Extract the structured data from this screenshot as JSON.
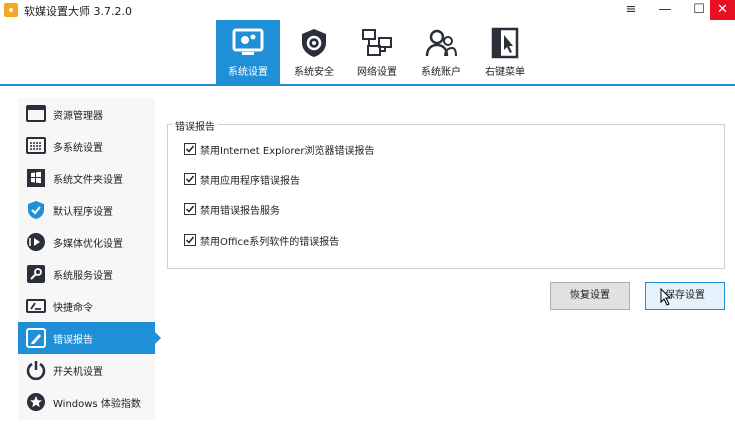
{
  "window": {
    "title": "软媒设置大师 3.7.2.0",
    "controls": {
      "menu": "≡",
      "minimize": "—",
      "maximize": "☐",
      "close": "✕"
    }
  },
  "toolbar": {
    "items": [
      {
        "label": "系统设置",
        "icon": "monitor-gear-icon",
        "active": true
      },
      {
        "label": "系统安全",
        "icon": "shield-gear-icon",
        "active": false
      },
      {
        "label": "网络设置",
        "icon": "network-icon",
        "active": false
      },
      {
        "label": "系统账户",
        "icon": "users-icon",
        "active": false
      },
      {
        "label": "右键菜单",
        "icon": "cursor-menu-icon",
        "active": false
      }
    ]
  },
  "sidebar": {
    "items": [
      {
        "label": "资源管理器",
        "icon": "explorer-icon",
        "active": false
      },
      {
        "label": "多系统设置",
        "icon": "multi-system-icon",
        "active": false
      },
      {
        "label": "系统文件夹设置",
        "icon": "windows-folder-icon",
        "active": false
      },
      {
        "label": "默认程序设置",
        "icon": "default-program-icon",
        "active": false
      },
      {
        "label": "多媒体优化设置",
        "icon": "multimedia-icon",
        "active": false
      },
      {
        "label": "系统服务设置",
        "icon": "service-icon",
        "active": false
      },
      {
        "label": "快捷命令",
        "icon": "command-icon",
        "active": false
      },
      {
        "label": "错误报告",
        "icon": "error-report-icon",
        "active": true
      },
      {
        "label": "开关机设置",
        "icon": "power-icon",
        "active": false
      },
      {
        "label": "Windows 体验指数",
        "icon": "star-icon",
        "active": false
      }
    ]
  },
  "main": {
    "group_title": "错误报告",
    "options": [
      {
        "label": "禁用Internet Explorer浏览器错误报告",
        "checked": true
      },
      {
        "label": "禁用应用程序错误报告",
        "checked": true
      },
      {
        "label": "禁用错误报告服务",
        "checked": true
      },
      {
        "label": "禁用Office系列软件的错误报告",
        "checked": true
      }
    ],
    "buttons": {
      "restore": "恢复设置",
      "save": "保存设置"
    }
  },
  "colors": {
    "accent": "#1f8fd8",
    "close": "#e81123",
    "sidebar_bg": "#f7f7f7"
  }
}
